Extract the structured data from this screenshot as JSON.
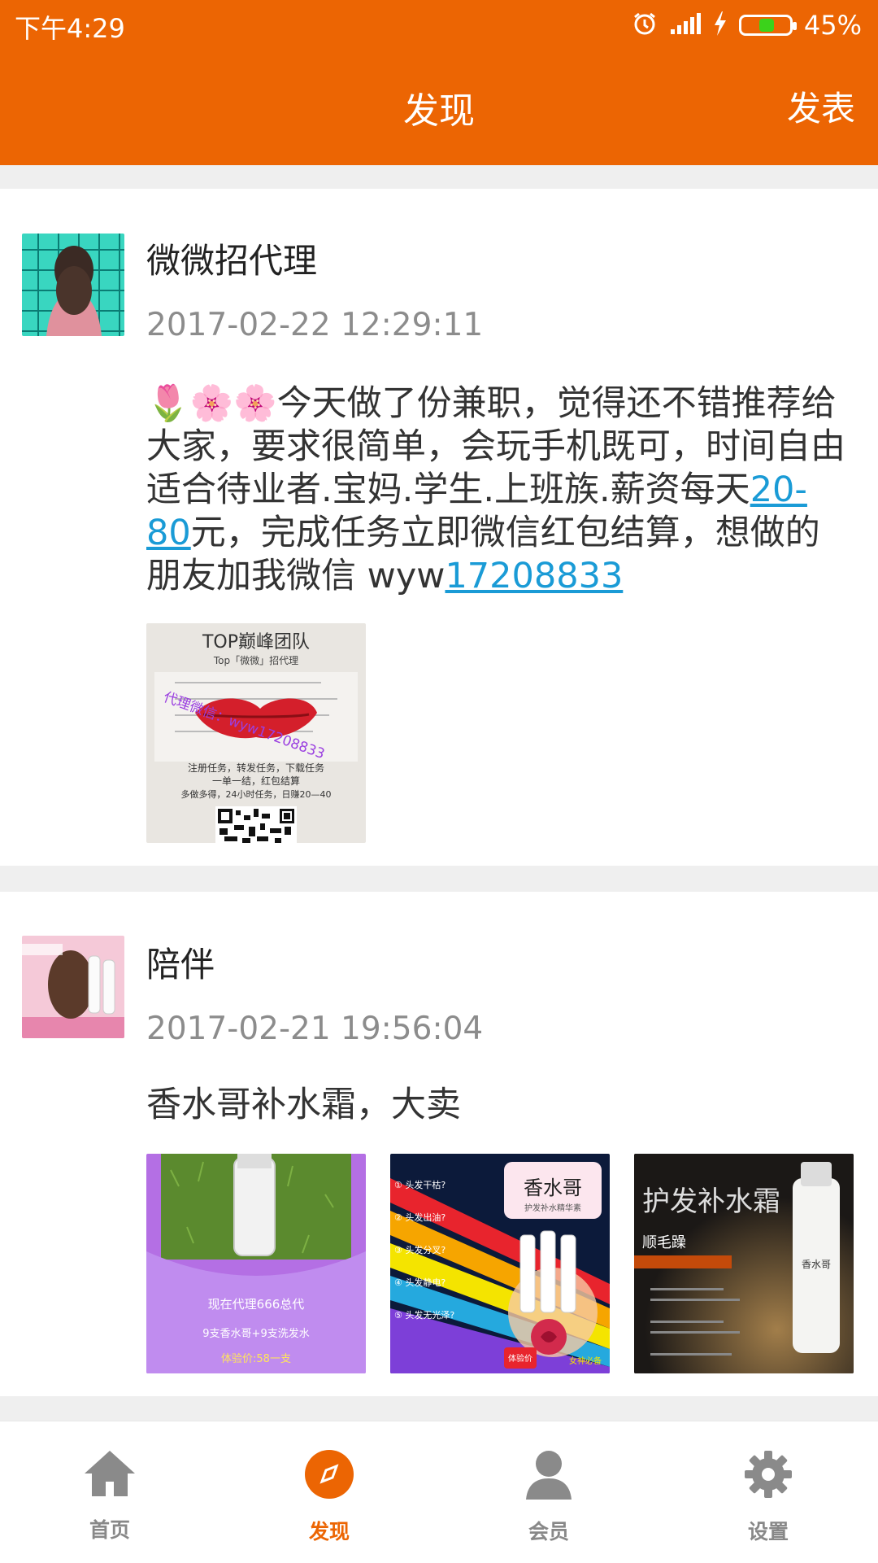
{
  "status_bar": {
    "time": "下午4:29",
    "battery_percent": "45%",
    "battery_level": 0.45
  },
  "header": {
    "title": "发现",
    "publish_label": "发表"
  },
  "posts": [
    {
      "user": "微微招代理",
      "timestamp": "2017-02-22 12:29:11",
      "content_text_1": "今天做了份兼职，觉得还不错推荐给大家，要求很简单，会玩手机既可，时间自由适合待业者.宝妈.学生.上班族.薪资每天",
      "content_link_1": "20-80",
      "content_text_2": "元，完成任务立即微信红包结算，想做的朋友加我微信 wyw",
      "content_link_2": "17208833",
      "image_text": {
        "title": "TOP巅峰团队",
        "subtitle": "Top「微微」招代理",
        "watermark": "代理微信：wyw17208833",
        "line1": "注册任务，转发任务，下载任务",
        "line2": "一单一结，红包结算",
        "line3": "多做多得，24小时任务，日赚20—40"
      }
    },
    {
      "user": "陪伴",
      "timestamp": "2017-02-21 19:56:04",
      "content": "香水哥补水霜，大卖",
      "images": [
        {
          "line1": "现在代理666总代",
          "line2": "9支香水哥+9支洗发水",
          "line3": "体验价:58一支"
        },
        {
          "brand": "香水哥",
          "sub": "护发补水精华素",
          "items": [
            "① 头发干枯?",
            "② 头发出油?",
            "③ 头发分叉?",
            "④ 头发静电?",
            "⑤ 头发无光泽?"
          ],
          "tag": "体验价",
          "badge": "女神必备"
        },
        {
          "title": "护发补水霜",
          "sub": "顺毛躁",
          "brand": "香水哥"
        }
      ]
    }
  ],
  "bottom_nav": [
    {
      "label": "首页",
      "icon": "home-icon",
      "active": false
    },
    {
      "label": "发现",
      "icon": "compass-icon",
      "active": true
    },
    {
      "label": "会员",
      "icon": "user-icon",
      "active": false
    },
    {
      "label": "设置",
      "icon": "gear-icon",
      "active": false
    }
  ],
  "colors": {
    "accent": "#ec6503",
    "link": "#1a9bd6",
    "muted": "#8c8c8c"
  }
}
